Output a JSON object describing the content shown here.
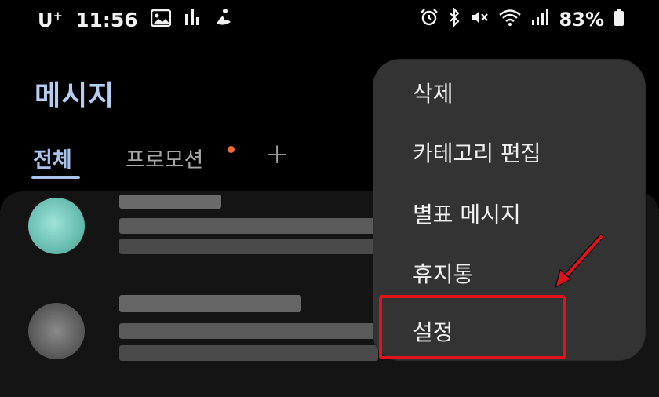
{
  "status_bar": {
    "carrier": "U",
    "carrier_mark": "+",
    "time": "11:56",
    "battery": "83%",
    "icons_left": [
      "gallery-icon",
      "chart-icon",
      "fitness-icon"
    ],
    "icons_right": [
      "alarm-icon",
      "bluetooth-icon",
      "mute-icon",
      "wifi-icon",
      "signal-icon",
      "battery-icon"
    ]
  },
  "header": {
    "title": "메시지"
  },
  "tabs": [
    {
      "label": "전체",
      "active": true
    },
    {
      "label": "프로모션",
      "has_badge": true,
      "badge_color": "#f26a3a"
    },
    {
      "label": "+"
    }
  ],
  "menu": {
    "items": [
      {
        "label": "삭제"
      },
      {
        "label": "카테고리 편집"
      },
      {
        "label": "별표 메시지"
      },
      {
        "label": "휴지통"
      },
      {
        "label": "설정",
        "highlighted": true
      }
    ]
  },
  "colors": {
    "accent": "#a9c3ef",
    "title": "#b5cdf0",
    "menu_bg": "#333333",
    "highlight": "#e0131b",
    "badge": "#f26a3a",
    "avatar_1": "#7fd1c4",
    "avatar_2": "#6e6e6e"
  }
}
